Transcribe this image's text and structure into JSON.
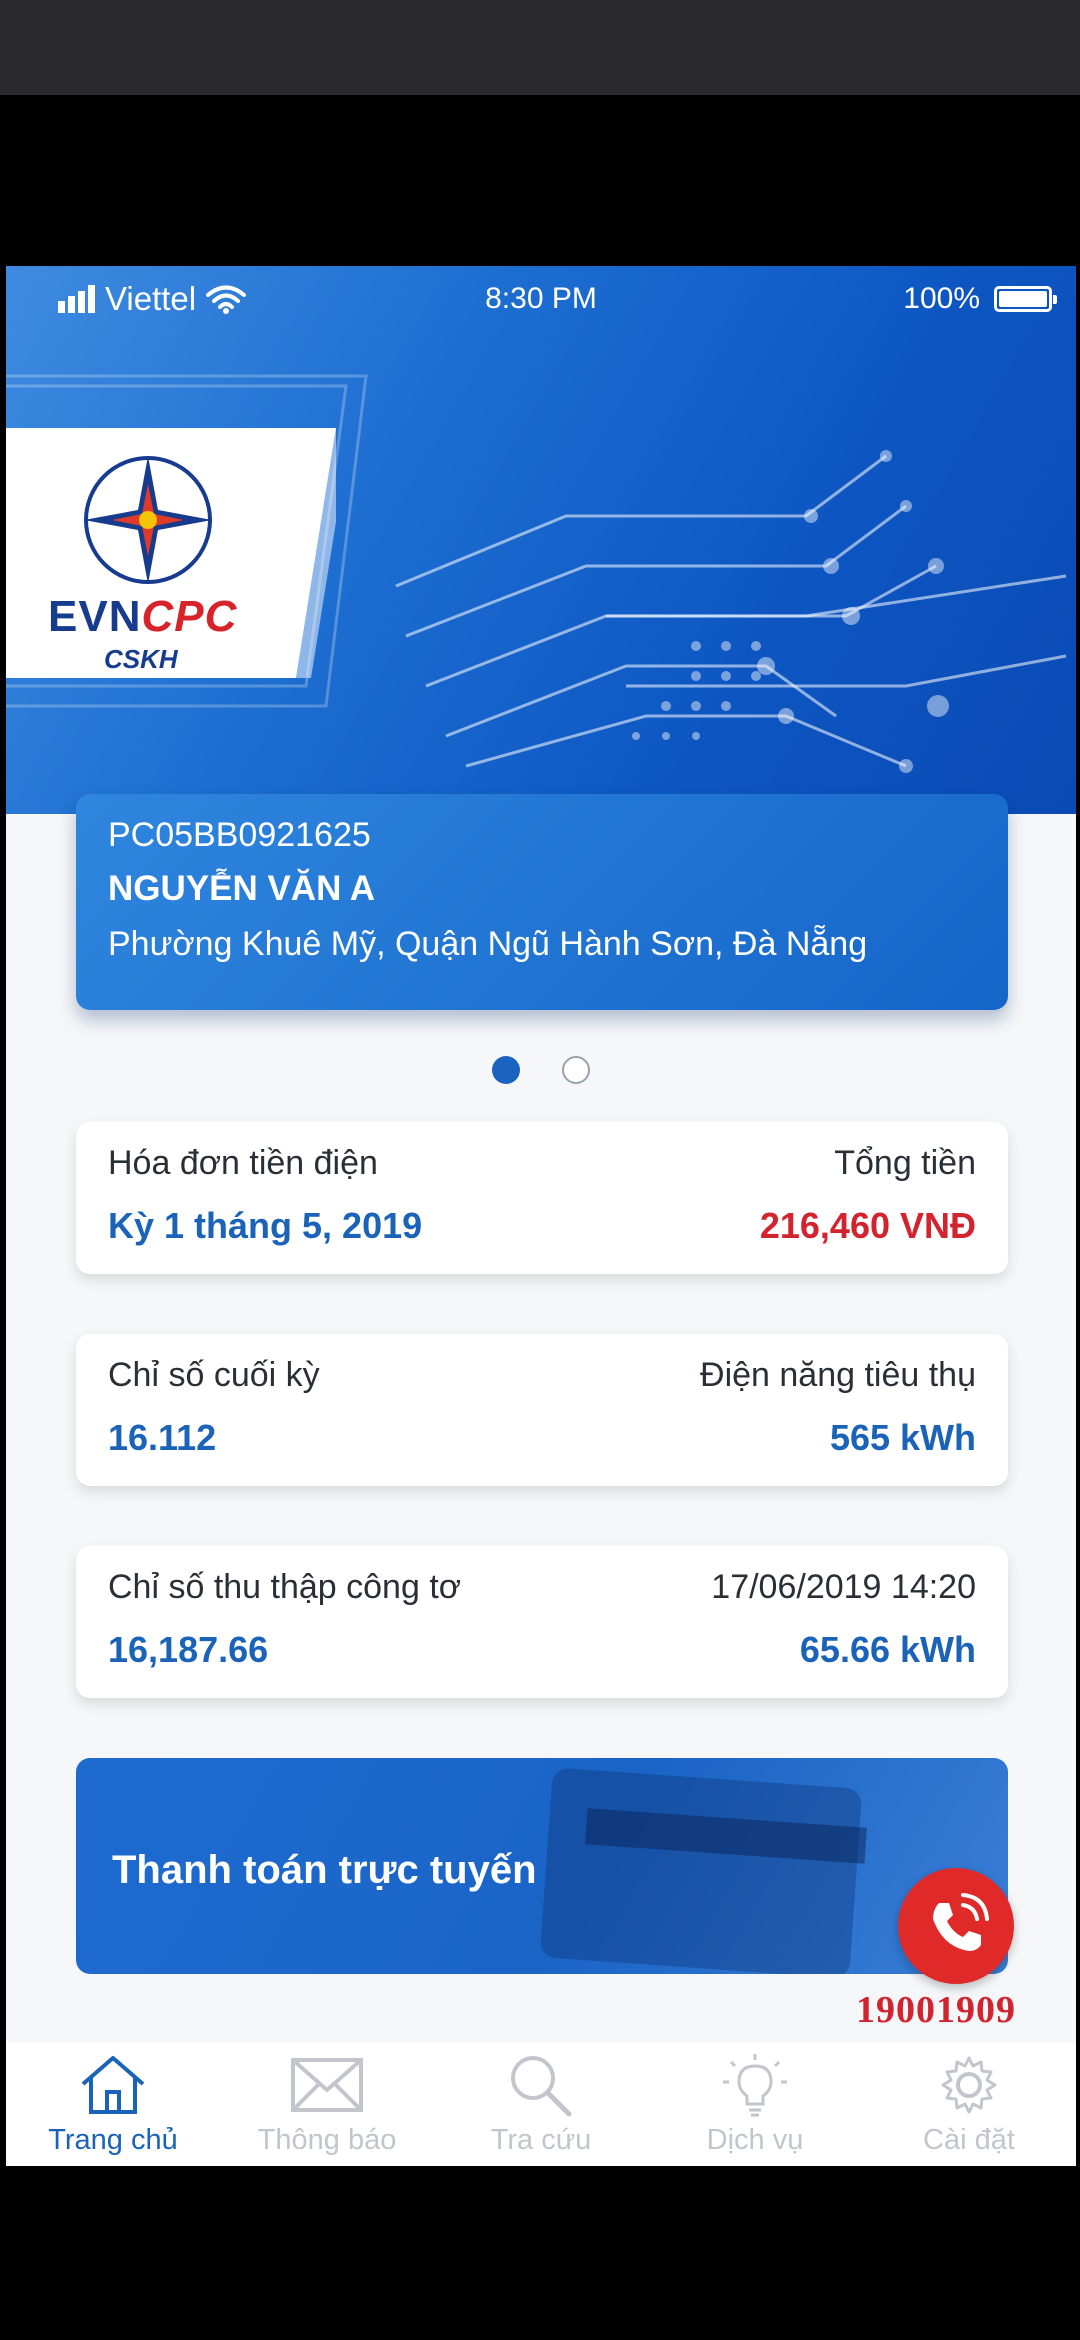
{
  "status_bar": {
    "carrier": "Viettel",
    "time": "8:30 PM",
    "battery": "100%"
  },
  "logo": {
    "brand_evn": "EVN",
    "brand_cpc": "CPC",
    "sub": "CSKH"
  },
  "customer": {
    "id": "PC05BB0921625",
    "name": "NGUYỄN VĂN A",
    "address": "Phường Khuê Mỹ, Quận Ngũ Hành Sơn, Đà Nẵng"
  },
  "pager": {
    "pages": 2,
    "active": 1
  },
  "bill": {
    "label": "Hóa đơn tiền điện",
    "period": "Kỳ 1 tháng 5, 2019",
    "total_label": "Tổng tiền",
    "total": "216,460 VNĐ"
  },
  "reading": {
    "label": "Chỉ số cuối kỳ",
    "value": "16.112",
    "usage_label": "Điện năng tiêu thụ",
    "usage": "565 kWh"
  },
  "meter": {
    "label": "Chỉ số thu thập công tơ",
    "value": "16,187.66",
    "datetime": "17/06/2019 14:20",
    "usage": "65.66 kWh"
  },
  "payment": {
    "label": "Thanh toán trực tuyến"
  },
  "hotline": {
    "number": "19001909"
  },
  "nav": [
    {
      "label": "Trang chủ",
      "icon": "home-icon",
      "active": true
    },
    {
      "label": "Thông báo",
      "icon": "mail-icon",
      "active": false
    },
    {
      "label": "Tra cứu",
      "icon": "search-icon",
      "active": false
    },
    {
      "label": "Dịch vụ",
      "icon": "lightbulb-icon",
      "active": false
    },
    {
      "label": "Cài đặt",
      "icon": "gear-icon",
      "active": false
    }
  ],
  "colors": {
    "primary": "#1a63b8",
    "accent_red": "#d3232e",
    "inactive": "#c2c6cc"
  }
}
